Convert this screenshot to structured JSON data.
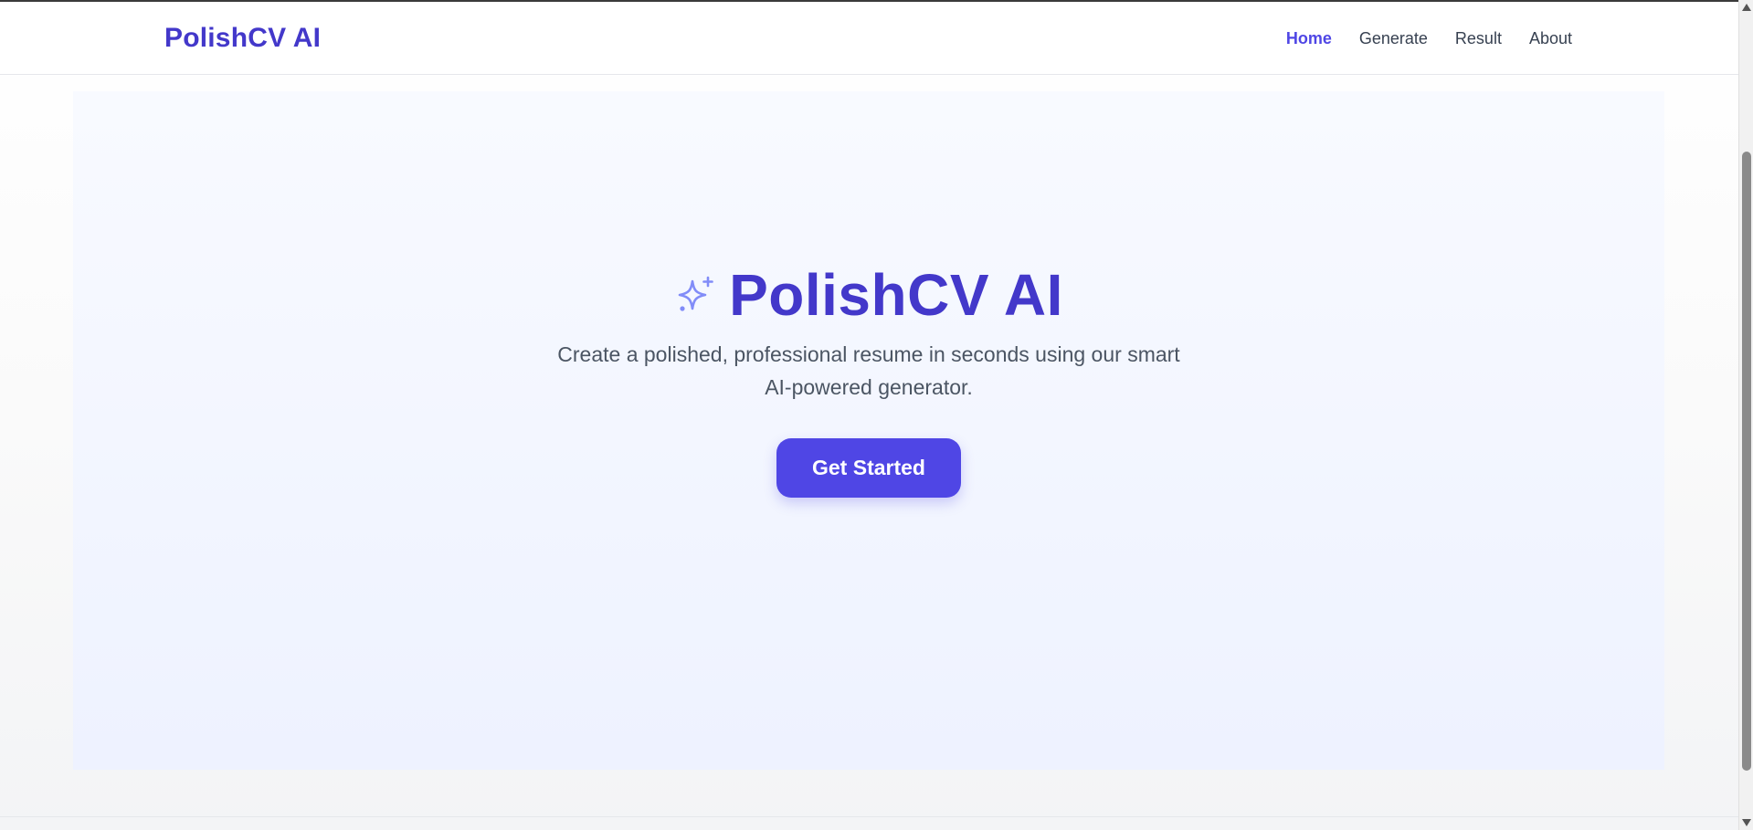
{
  "navbar": {
    "brand": "PolishCV AI",
    "links": [
      {
        "label": "Home",
        "active": true
      },
      {
        "label": "Generate",
        "active": false
      },
      {
        "label": "Result",
        "active": false
      },
      {
        "label": "About",
        "active": false
      }
    ]
  },
  "hero": {
    "icon": "sparkles-icon",
    "title": "PolishCV AI",
    "subtitle_line1": "Create a polished, professional resume in seconds using our smart",
    "subtitle_line2": "AI-powered generator.",
    "cta_label": "Get Started"
  },
  "colors": {
    "brand": "#4338ca",
    "accent": "#4f46e5",
    "icon": "#818cf8",
    "text_muted": "#4b5563"
  }
}
